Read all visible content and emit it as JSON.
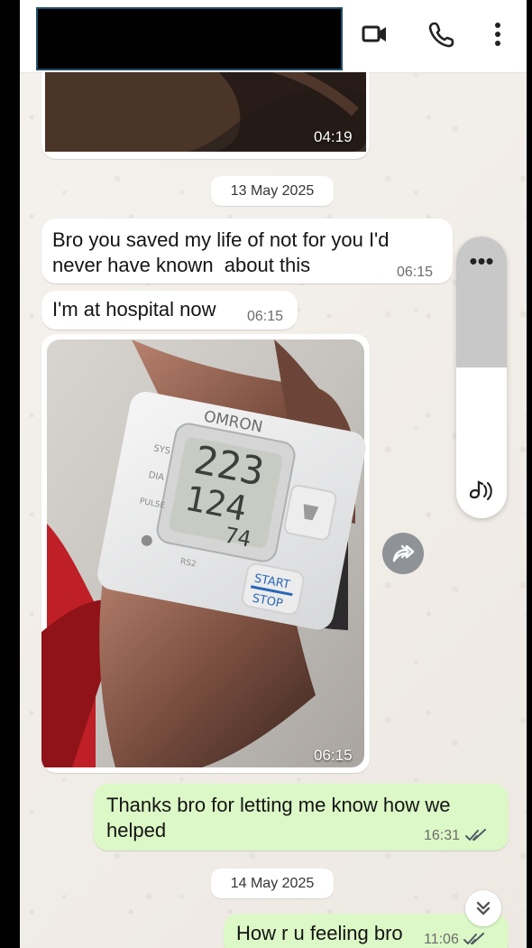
{
  "header": {
    "video_call_icon": "video-call-icon",
    "voice_call_icon": "phone-icon",
    "menu_icon": "more-vertical-icon"
  },
  "messages": {
    "top_photo": {
      "time": "04:19"
    },
    "date_1": "13 May 2025",
    "message_1": {
      "text": "Bro you saved my life of not for you I'd\nnever have known  about this",
      "time": "06:15"
    },
    "message_2": {
      "text": "I'm at hospital now",
      "time": "06:15"
    },
    "photo_message": {
      "time": "06:15",
      "display_sys": "223",
      "display_dia": "124",
      "display_pulse": "74",
      "brand": "OMRON",
      "button_label_1": "START",
      "button_label_2": "STOP"
    },
    "message_3": {
      "text": "Thanks bro for letting me know how we\nhelped",
      "time": "16:31"
    },
    "date_2": "14 May 2025",
    "message_4": {
      "text": "How r u feeling bro",
      "time": "11:06"
    }
  },
  "audio_panel": {
    "more_label": "•••",
    "audio_icon": "audio-icon",
    "volume_level": 0.46
  },
  "colors": {
    "incoming_bubble": "#ffffff",
    "outgoing_bubble": "#dcf8c6",
    "chat_background": "#f1ece6",
    "read_ticks": "#4f5b66"
  }
}
